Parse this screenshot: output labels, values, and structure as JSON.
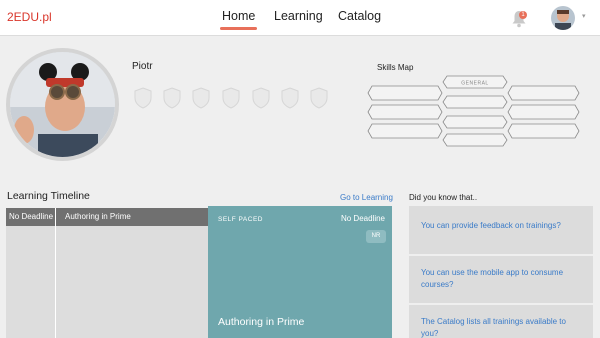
{
  "header": {
    "logo": "2EDU.pl",
    "nav": [
      {
        "label": "Home",
        "active": true
      },
      {
        "label": "Learning",
        "active": false
      },
      {
        "label": "Catalog",
        "active": false
      }
    ],
    "notification_count": "1",
    "icons": {
      "bell": "bell-icon",
      "caret": "chevron-down-icon"
    },
    "accent_color": "#e8705a"
  },
  "profile": {
    "name": "Piotr",
    "badge_count_icons": "shield-icon"
  },
  "skills_map": {
    "title": "Skills Map",
    "general_label": "GENERAL"
  },
  "timeline": {
    "title": "Learning Timeline",
    "link": "Go to Learning",
    "columns": [
      "No Deadline",
      "Authoring in Prime"
    ]
  },
  "card": {
    "type": "SELF PACED",
    "deadline": "No Deadline",
    "tag": "NR",
    "title": "Authoring in Prime",
    "color": "#6fa7ad"
  },
  "did_you_know": {
    "title": "Did you know that..",
    "items": [
      "You can provide feedback on trainings?",
      "You can use the mobile app to consume courses?",
      "The Catalog lists all trainings available to you?"
    ]
  }
}
